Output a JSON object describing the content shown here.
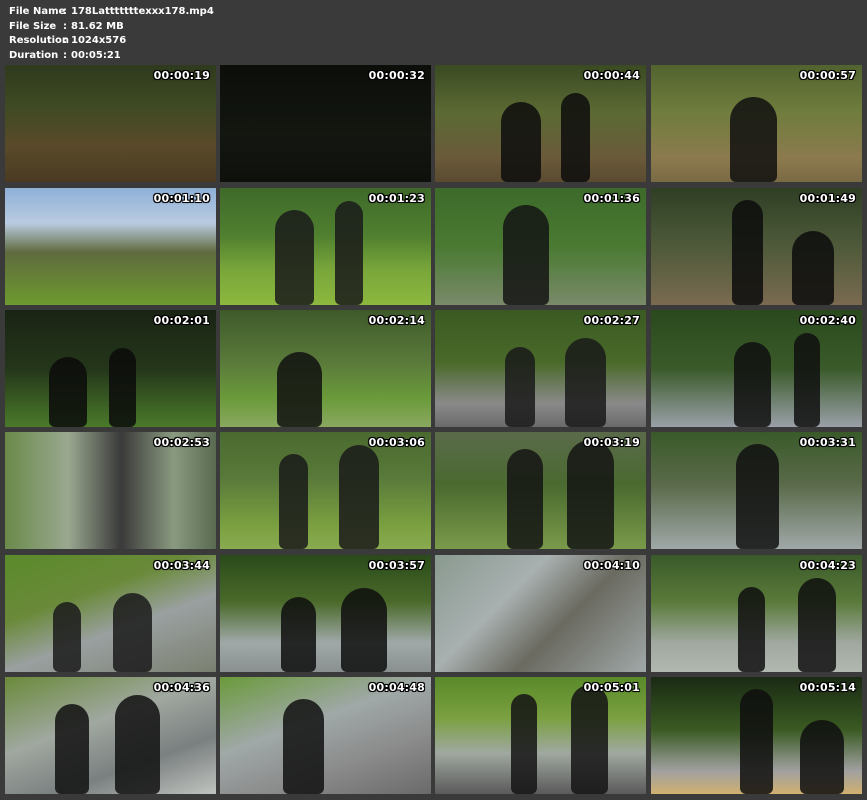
{
  "header": {
    "file_name_label": "File Name",
    "file_name": "178Latttttttexxx178.mp4",
    "file_size_label": "File Size",
    "file_size": "81.62 MB",
    "resolution_label": "Resolution",
    "resolution": "1024x576",
    "duration_label": "Duration",
    "duration": "00:05:21",
    "separator": ":"
  },
  "thumbnails": [
    {
      "time": "00:00:19",
      "bg": "linear-gradient(180deg,#2f3a1e 0%,#3e4a23 35%,#5a4a2a 70%,#4a3a22 100%)",
      "fig": ""
    },
    {
      "time": "00:00:32",
      "bg": "linear-gradient(180deg,#0c0e0a 0%,#131710 60%,#0e100c 100%)",
      "fig": ""
    },
    {
      "time": "00:00:44",
      "bg": "linear-gradient(180deg,#3a4a22 0%,#5b6a33 40%,#6a5a3a 80%,#5a4a30 100%)",
      "fig": "#0d0d0d"
    },
    {
      "time": "00:00:57",
      "bg": "linear-gradient(180deg,#52632f 0%,#6f7d3d 40%,#8c7a4e 80%,#7a6a44 100%)",
      "fig": "#111111"
    },
    {
      "time": "00:01:10",
      "bg": "linear-gradient(180deg,#8fb0d8 0%,#b9cbe0 30%,#5f6a3e 55%,#6c9a2e 100%)",
      "fig": ""
    },
    {
      "time": "00:01:23",
      "bg": "linear-gradient(180deg,#3f6a2a 0%,#4f7f2f 40%,#79a63a 70%,#8cb83f 100%)",
      "fig": "#1a1a1a"
    },
    {
      "time": "00:01:36",
      "bg": "linear-gradient(180deg,#3d6a2a 0%,#4a7a32 50%,#7a8a6a 100%)",
      "fig": "#141414"
    },
    {
      "time": "00:01:49",
      "bg": "linear-gradient(180deg,#2f3f24 0%,#4e5a3a 50%,#7a6a50 100%)",
      "fig": "#0c0c0c"
    },
    {
      "time": "00:02:01",
      "bg": "linear-gradient(180deg,#1a2414 0%,#24361a 50%,#4a7a2a 100%)",
      "fig": "#0a0a0a"
    },
    {
      "time": "00:02:14",
      "bg": "linear-gradient(180deg,#3e5a2a 0%,#5a7a3a 45%,#6a9a3a 75%,#8aa860 100%)",
      "fig": "#111111"
    },
    {
      "time": "00:02:27",
      "bg": "linear-gradient(180deg,#3a5a22 0%,#4a6a2a 45%,#8a8a8a 80%,#6a6a6a 100%)",
      "fig": "#1a1a1a"
    },
    {
      "time": "00:02:40",
      "bg": "linear-gradient(180deg,#2a4a1e 0%,#3a5a2a 50%,#9aa0a8 100%)",
      "fig": "#0f0f0f"
    },
    {
      "time": "00:02:53",
      "bg": "linear-gradient(90deg,#6a8a4a 0%,#9aa890 30%,#3a3a3a 55%,#8a9a80 80%,#5a6a50 100%)",
      "fig": ""
    },
    {
      "time": "00:03:06",
      "bg": "linear-gradient(180deg,#4a6a30 0%,#5a7a3a 40%,#7aa040 80%,#8aaa50 100%)",
      "fig": "#1a1a1a"
    },
    {
      "time": "00:03:19",
      "bg": "linear-gradient(180deg,#5a6a4a 0%,#4a6a30 45%,#7a9a4a 100%)",
      "fig": "#141414"
    },
    {
      "time": "00:03:31",
      "bg": "linear-gradient(180deg,#3a5a2a 0%,#5a6a4a 45%,#a0a8a8 100%)",
      "fig": "#101010"
    },
    {
      "time": "00:03:44",
      "bg": "linear-gradient(160deg,#5a8a2a 0%,#6a8a3a 35%,#9aa0a0 60%,#7a8070 100%)",
      "fig": "#1a1a1a"
    },
    {
      "time": "00:03:57",
      "bg": "linear-gradient(180deg,#2a4a1a 0%,#4a6a2a 40%,#a0a8a8 75%,#8a9090 100%)",
      "fig": "#0e0e0e"
    },
    {
      "time": "00:04:10",
      "bg": "linear-gradient(135deg,#8a9a90 0%,#a8b0b0 35%,#6a6a60 60%,#a0a8a8 100%)",
      "fig": ""
    },
    {
      "time": "00:04:23",
      "bg": "linear-gradient(180deg,#3a5a2a 0%,#5a7a3a 40%,#a0a8a0 75%,#b0b8b0 100%)",
      "fig": "#0f0f0f"
    },
    {
      "time": "00:04:36",
      "bg": "linear-gradient(160deg,#6a8a3a 0%,#a0a8a0 40%,#7a8080 70%,#c0c4c0 100%)",
      "fig": "#111111"
    },
    {
      "time": "00:04:48",
      "bg": "linear-gradient(160deg,#6a9a3a 0%,#a0a8a8 40%,#8a8a8a 70%,#6a6a6a 100%)",
      "fig": "#101010"
    },
    {
      "time": "00:05:01",
      "bg": "linear-gradient(180deg,#5a8a2a 0%,#7aa040 35%,#a0a8a0 65%,#5a5a5a 100%)",
      "fig": "#141414"
    },
    {
      "time": "00:05:14",
      "bg": "linear-gradient(180deg,#1a2a14 0%,#3a5a22 45%,#a0a0a0 80%,#d0b070 100%)",
      "fig": "#0e0e0e"
    }
  ]
}
